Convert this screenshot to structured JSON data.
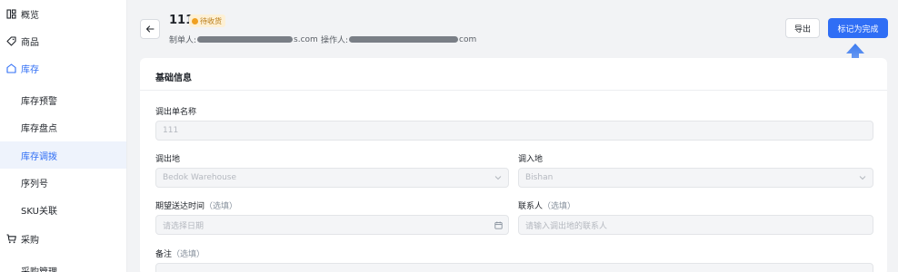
{
  "sidebar": {
    "items": [
      {
        "label": "概览",
        "icon": "overview-icon"
      },
      {
        "label": "商品",
        "icon": "tag-icon"
      },
      {
        "label": "库存",
        "icon": "warehouse-icon"
      },
      {
        "label": "库存预警"
      },
      {
        "label": "库存盘点"
      },
      {
        "label": "库存调拨"
      },
      {
        "label": "序列号"
      },
      {
        "label": "SKU关联"
      },
      {
        "label": "采购",
        "icon": "cart-icon"
      },
      {
        "label": "采购管理"
      }
    ]
  },
  "header": {
    "title": "111",
    "status": "待收货",
    "creator_label": "制单人:",
    "creator_suffix": "s.com",
    "operator_label": "操作人:",
    "operator_suffix": "com",
    "export_label": "导出",
    "complete_label": "标记为完成"
  },
  "card": {
    "title": "基础信息",
    "fields": {
      "name": {
        "label": "调出单名称",
        "value": "111"
      },
      "from": {
        "label": "调出地",
        "value": "Bedok Warehouse"
      },
      "to": {
        "label": "调入地",
        "value": "Bishan"
      },
      "date": {
        "label": "期望送达时间",
        "optional": "（选填）",
        "placeholder": "请选择日期"
      },
      "contact": {
        "label": "联系人",
        "optional": "（选填）",
        "placeholder": "请输入调出地的联系人"
      },
      "note": {
        "label": "备注",
        "optional": "（选填）"
      }
    }
  },
  "colors": {
    "accent": "#2f6ef5",
    "status_bg": "#fdf0d5",
    "status_text": "#b87a14",
    "annotation_arrow": "#3a7af0"
  }
}
